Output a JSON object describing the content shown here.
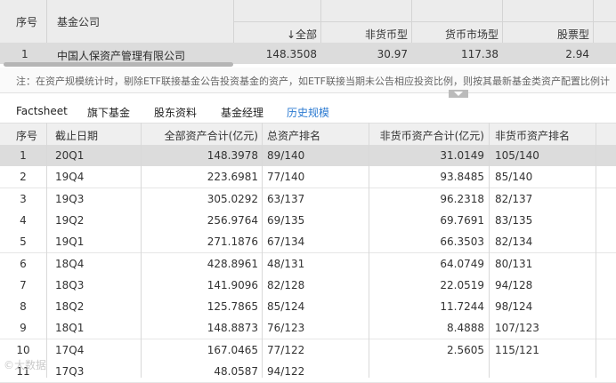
{
  "summary_table": {
    "headers": {
      "index": "序号",
      "company": "基金公司",
      "total": "↓全部",
      "non_monetary": "非货币型",
      "money_market": "货币市场型",
      "equity": "股票型"
    },
    "row": {
      "index": "1",
      "company": "中国人保资产管理有限公司",
      "total": "148.3508",
      "non_monetary": "30.97",
      "money_market": "117.38",
      "equity": "2.94"
    }
  },
  "note": "注：在资产规模统计时，剔除ETF联接基金公告投资基金的资产，如ETF联接当期未公告相应投资比例，则按其最新基金类资产配置比例计",
  "tabs": [
    "Factsheet",
    "旗下基金",
    "股东资料",
    "基金经理",
    "历史规模"
  ],
  "active_tab": "历史规模",
  "accent_color": "#2b7ad1",
  "history_table": {
    "headers": {
      "index": "序号",
      "date": "截止日期",
      "total_assets": "全部资产合计(亿元)",
      "total_rank": "总资产排名",
      "non_monetary_assets": "非货币资产合计(亿元)",
      "non_monetary_rank": "非货币资产排名"
    },
    "rows": [
      {
        "index": "1",
        "date": "20Q1",
        "total_assets": "148.3978",
        "total_rank": "89/140",
        "non_monetary_assets": "31.0149",
        "non_monetary_rank": "105/140"
      },
      {
        "index": "2",
        "date": "19Q4",
        "total_assets": "223.6981",
        "total_rank": "77/140",
        "non_monetary_assets": "93.8485",
        "non_monetary_rank": "85/140"
      },
      {
        "index": "3",
        "date": "19Q3",
        "total_assets": "305.0292",
        "total_rank": "63/137",
        "non_monetary_assets": "96.2318",
        "non_monetary_rank": "82/137"
      },
      {
        "index": "4",
        "date": "19Q2",
        "total_assets": "256.9764",
        "total_rank": "69/135",
        "non_monetary_assets": "69.7691",
        "non_monetary_rank": "83/135"
      },
      {
        "index": "5",
        "date": "19Q1",
        "total_assets": "271.1876",
        "total_rank": "67/134",
        "non_monetary_assets": "66.3503",
        "non_monetary_rank": "82/134"
      },
      {
        "index": "6",
        "date": "18Q4",
        "total_assets": "428.8961",
        "total_rank": "48/131",
        "non_monetary_assets": "64.0749",
        "non_monetary_rank": "80/131"
      },
      {
        "index": "7",
        "date": "18Q3",
        "total_assets": "141.9096",
        "total_rank": "82/128",
        "non_monetary_assets": "22.0519",
        "non_monetary_rank": "94/128"
      },
      {
        "index": "8",
        "date": "18Q2",
        "total_assets": "125.7865",
        "total_rank": "85/124",
        "non_monetary_assets": "11.7244",
        "non_monetary_rank": "98/124"
      },
      {
        "index": "9",
        "date": "18Q1",
        "total_assets": "148.8873",
        "total_rank": "76/123",
        "non_monetary_assets": "8.4888",
        "non_monetary_rank": "107/123"
      },
      {
        "index": "10",
        "date": "17Q4",
        "total_assets": "167.0465",
        "total_rank": "77/122",
        "non_monetary_assets": "2.5605",
        "non_monetary_rank": "115/121"
      },
      {
        "index": "11",
        "date": "17Q3",
        "total_assets": "48.0587",
        "total_rank": "94/122",
        "non_monetary_assets": "",
        "non_monetary_rank": ""
      }
    ]
  },
  "watermark": "©大数据"
}
